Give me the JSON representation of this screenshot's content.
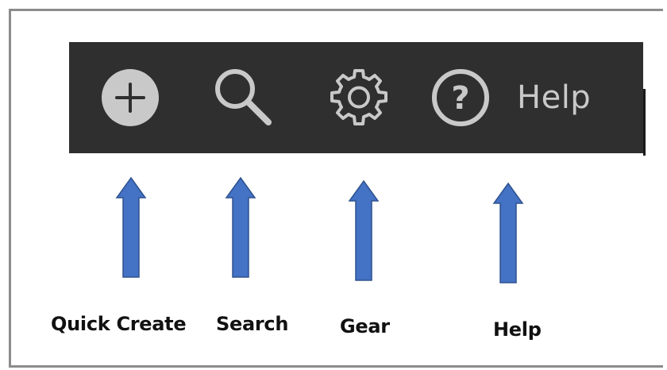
{
  "toolbar": {
    "buttons": [
      {
        "id": "quick-create",
        "icon": "plus-circle-icon"
      },
      {
        "id": "search",
        "icon": "search-icon"
      },
      {
        "id": "gear",
        "icon": "gear-icon"
      },
      {
        "id": "help",
        "icon": "help-circle-icon",
        "label": "Help"
      }
    ]
  },
  "annotations": {
    "quick_create": "Quick Create",
    "search": "Search",
    "gear": "Gear",
    "help": "Help"
  },
  "colors": {
    "toolbar_bg": "#2f2f30",
    "icon": "#c9c9c9",
    "arrow_fill": "#4472c4",
    "arrow_stroke": "#2f528f",
    "frame_border": "#8c8c8c"
  }
}
